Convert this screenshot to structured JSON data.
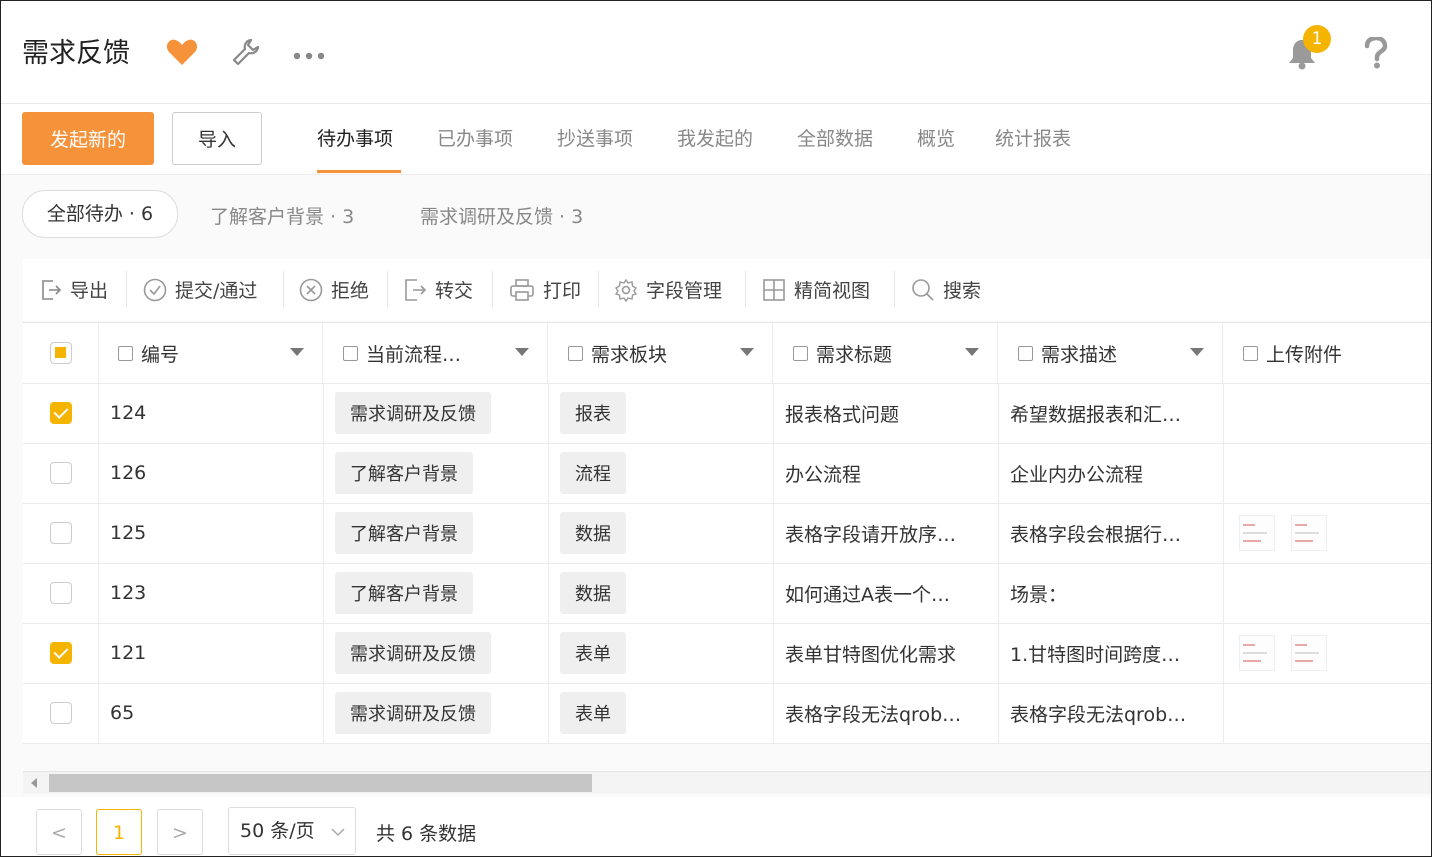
{
  "app": {
    "title": "需求反馈",
    "notification_count": "1"
  },
  "colors": {
    "accent": "#f5923a",
    "checkbox": "#f5b400"
  },
  "toolbar": {
    "new_label": "发起新的",
    "import_label": "导入"
  },
  "tabs": [
    "待办事项",
    "已办事项",
    "抄送事项",
    "我发起的",
    "全部数据",
    "概览",
    "统计报表"
  ],
  "active_tab": "待办事项",
  "filters": [
    "全部待办 · 6",
    "了解客户背景 · 3",
    "需求调研及反馈 · 3"
  ],
  "actions": [
    "导出",
    "提交/通过",
    "拒绝",
    "转交",
    "打印",
    "字段管理",
    "精简视图",
    "搜索"
  ],
  "columns": [
    "编号",
    "当前流程…",
    "需求板块",
    "需求标题",
    "需求描述",
    "上传附件"
  ],
  "rows": [
    {
      "checked": true,
      "id": "124",
      "flow": "需求调研及反馈",
      "module": "报表",
      "title": "报表格式问题",
      "desc": "希望数据报表和汇…",
      "attachments": 0
    },
    {
      "checked": false,
      "id": "126",
      "flow": "了解客户背景",
      "module": "流程",
      "title": "办公流程",
      "desc": "企业内办公流程",
      "attachments": 0
    },
    {
      "checked": false,
      "id": "125",
      "flow": "了解客户背景",
      "module": "数据",
      "title": "表格字段请开放序…",
      "desc": "表格字段会根据行…",
      "attachments": 2
    },
    {
      "checked": false,
      "id": "123",
      "flow": "了解客户背景",
      "module": "数据",
      "title": "如何通过A表一个…",
      "desc": "场景：",
      "attachments": 0
    },
    {
      "checked": true,
      "id": "121",
      "flow": "需求调研及反馈",
      "module": "表单",
      "title": "表单甘特图优化需求",
      "desc": "1.甘特图时间跨度…",
      "attachments": 2
    },
    {
      "checked": false,
      "id": "65",
      "flow": "需求调研及反馈",
      "module": "表单",
      "title": "表格字段无法qrob…",
      "desc": "表格字段无法qrob…",
      "attachments": 0
    }
  ],
  "pagination": {
    "current_page": "1",
    "page_size": "50 条/页",
    "total": "共 6 条数据",
    "prev": "<",
    "next": ">"
  }
}
